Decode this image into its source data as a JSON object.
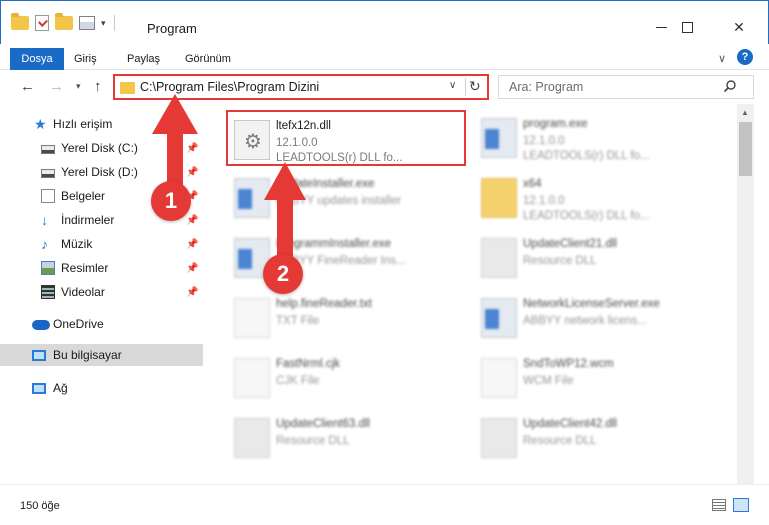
{
  "window": {
    "title": "Program"
  },
  "ribbon": {
    "tabs": [
      "Dosya",
      "Giriş",
      "Paylaş",
      "Görünüm"
    ]
  },
  "address": {
    "path": "C:\\Program Files\\Program Dizini"
  },
  "search": {
    "placeholder": "Ara: Program"
  },
  "sidebar": {
    "items": [
      {
        "label": "Hızlı erişim",
        "icon": "star-icon",
        "pinned": false
      },
      {
        "label": "Yerel Disk (C:)",
        "icon": "drive-icon",
        "pinned": true
      },
      {
        "label": "Yerel Disk (D:)",
        "icon": "drive-icon",
        "pinned": true
      },
      {
        "label": "Belgeler",
        "icon": "documents-icon",
        "pinned": true
      },
      {
        "label": "İndirmeler",
        "icon": "download-icon",
        "pinned": true
      },
      {
        "label": "Müzik",
        "icon": "music-icon",
        "pinned": true
      },
      {
        "label": "Resimler",
        "icon": "pictures-icon",
        "pinned": true
      },
      {
        "label": "Videolar",
        "icon": "videos-icon",
        "pinned": true
      },
      {
        "label": "OneDrive",
        "icon": "onedrive-icon",
        "pinned": false
      },
      {
        "label": "Bu bilgisayar",
        "icon": "computer-icon",
        "pinned": false
      },
      {
        "label": "Ağ",
        "icon": "network-icon",
        "pinned": false
      }
    ]
  },
  "files": [
    {
      "name": "ltefx12n.dll",
      "line1": "12.1.0.0",
      "line2": "LEADTOOLS(r) DLL fo...",
      "icon": "dll-icon"
    },
    {
      "name": "program.exe",
      "line1": "12.1.0.0",
      "line2": "LEADTOOLS(r) DLL fo...",
      "icon": "application-icon"
    },
    {
      "name": "UpdateInstaller.exe",
      "line1": "ABBYY updates installer",
      "line2": "",
      "icon": "application-icon"
    },
    {
      "name": "x64",
      "line1": "12.1.0.0",
      "line2": "LEADTOOLS(r) DLL fo...",
      "icon": "folder-icon"
    },
    {
      "name": "ProgrammInstaller.exe",
      "line1": "ABBYY FineReader Ins...",
      "line2": "",
      "icon": "application-icon"
    },
    {
      "name": "UpdateClient21.dll",
      "line1": "Resource DLL",
      "line2": "",
      "icon": "dll-icon"
    },
    {
      "name": "help.fineReader.txt",
      "line1": "TXT File",
      "line2": "",
      "icon": "text-file-icon"
    },
    {
      "name": "NetworkLicenseServer.exe",
      "line1": "ABBYY network licens...",
      "line2": "",
      "icon": "application-icon"
    },
    {
      "name": "FastNrml.cjk",
      "line1": "CJK File",
      "line2": "",
      "icon": "text-file-icon"
    },
    {
      "name": "SndToWP12.wcm",
      "line1": "WCM File",
      "line2": "",
      "icon": "text-file-icon"
    },
    {
      "name": "UpdateClient63.dll",
      "line1": "Resource DLL",
      "line2": "",
      "icon": "dll-icon"
    },
    {
      "name": "UpdateClient42.dll",
      "line1": "Resource DLL",
      "line2": "",
      "icon": "dll-icon"
    }
  ],
  "status": {
    "item_count": "150 öğe"
  },
  "annotations": {
    "step1": "1",
    "step2": "2"
  },
  "colors": {
    "accent": "#1a6bc6",
    "highlight": "#e53935"
  }
}
